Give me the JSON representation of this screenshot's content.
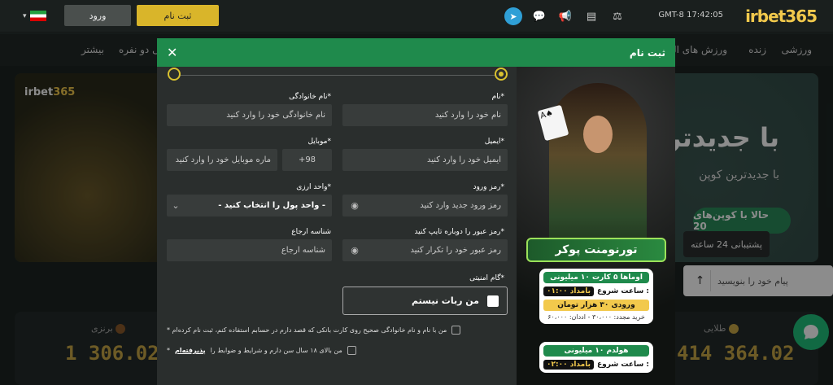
{
  "topbar": {
    "logo_main": "irbet",
    "logo_num": "365",
    "clock": "GMT-8   17:42:05",
    "register_label": "ثبت نام",
    "login_label": "ورود"
  },
  "nav": {
    "items": [
      "ورزشی",
      "زنده",
      "ورزش های الک",
      "بی دو نفره",
      "بیشتر"
    ]
  },
  "background": {
    "logo_main": "irbet",
    "logo_num": "365",
    "headline": "با جدیدتر",
    "subline": "با جدیدترین کوپن",
    "cta": "حالا با کوپن‌های 20",
    "support": "پشتیبانی 24 ساعته",
    "chat_placeholder": "پیام خود را بنویسید",
    "jackpot_left_label": "برنزی",
    "jackpot_left_value": "1 306.02",
    "jackpot_right_label": "طلایی",
    "jackpot_right_value": "414 364.02",
    "colors": {
      "accent": "#d9b52a",
      "green": "#1f8a4c"
    }
  },
  "modal": {
    "title": "ثبت نام",
    "fields": {
      "first_name": {
        "label": "نام*",
        "placeholder": "نام خود را وارد کنید"
      },
      "last_name": {
        "label": "نام خانوادگی*",
        "placeholder": "نام خانوادگی خود را وارد کنید"
      },
      "email": {
        "label": "ایمیل*",
        "placeholder": "ایمیل خود را وارد کنید"
      },
      "mobile": {
        "label": "موبایل*",
        "prefix": "+98",
        "placeholder": "ماره موبایل خود را وارد کنید"
      },
      "password": {
        "label": "رمز ورود*",
        "placeholder": "رمز ورود جدید وارد کنید"
      },
      "currency": {
        "label": "واحد ارزی*",
        "value": "- واحد پول را انتخاب کنید -"
      },
      "password_repeat": {
        "label": "رمز عبور را دوباره تایپ کنید*",
        "placeholder": "رمز عبور خود را تکرار کنید"
      },
      "referral": {
        "label": "شناسه ارجاع",
        "placeholder": "شناسه ارجاع"
      }
    },
    "security_label": "گام امنیتی*",
    "captcha_label": "من ربات نیستم",
    "terms1": "من با نام و نام خانوادگی صحیح روی کارت بانکی که قصد دارم در حسابم استفاده کنم، ثبت نام کرده‌ام *",
    "terms2_pre": "من بالای ۱۸ سال سن دارم و شرایط و ضوابط را",
    "terms2_link": "پذیرفته‌ام",
    "terms2_post": "*"
  },
  "promo": {
    "card_text": "A♠",
    "title": "تورنومنت پوکر",
    "ticket1": {
      "head": "اوماها ۵ کارت ۱۰ میلیونی",
      "start_label": "ساعت شروع :",
      "time": "۰۱:۰۰ بامداد",
      "entry": "ورودی ۳۰ هزار تومان",
      "buy": "خرید مجدد: ۳۰،۰۰۰ - اددان: ۶۰،۰۰۰"
    },
    "ticket2": {
      "head": "هولدم ۱۰ میلیونی",
      "start_label": "ساعت شروع :",
      "time": "۰۲:۰۰ بامداد"
    }
  }
}
